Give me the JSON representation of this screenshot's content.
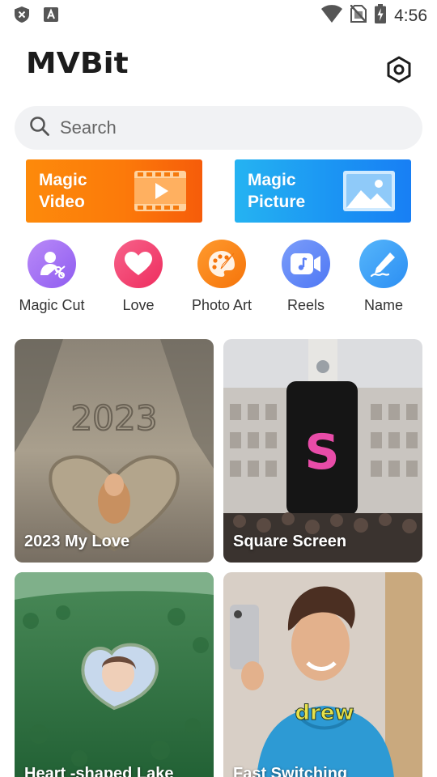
{
  "status_bar": {
    "time": "4:56",
    "left_icons": [
      "shield-x-icon",
      "font-a-icon"
    ],
    "right_icons": [
      "wifi-icon",
      "no-sim-icon",
      "battery-charging-icon"
    ]
  },
  "header": {
    "logo": "MVBit",
    "settings_icon": "gear-icon"
  },
  "search": {
    "placeholder": "Search"
  },
  "banners": [
    {
      "label": "Magic\nVideo",
      "icon": "film-icon",
      "color": "#fc7a0a"
    },
    {
      "label": "Magic\nPicture",
      "icon": "picture-icon",
      "color": "#1b95f3"
    }
  ],
  "tools": [
    {
      "label": "Magic Cut",
      "icon": "magic-cut-icon",
      "color": "#a36ff4"
    },
    {
      "label": "Love",
      "icon": "heart-icon",
      "color": "#f2416f"
    },
    {
      "label": "Photo Art",
      "icon": "palette-icon",
      "color": "#fb8013"
    },
    {
      "label": "Reels",
      "icon": "reels-icon",
      "color": "#5e89f8"
    },
    {
      "label": "Name",
      "icon": "pen-icon",
      "color": "#3aa0f7"
    }
  ],
  "templates": [
    {
      "title": "2023 My Love"
    },
    {
      "title": "Square Screen"
    },
    {
      "title": "Heart -shaped Lake"
    },
    {
      "title": "Fast Switching"
    }
  ]
}
